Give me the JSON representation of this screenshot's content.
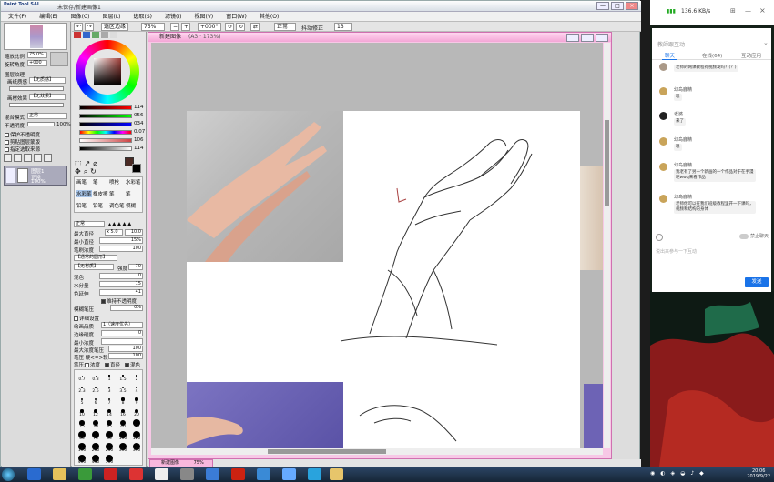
{
  "app": {
    "logo": "Paint Tool SAI",
    "document_title": "未保存/新建画像1",
    "window_controls": [
      "—",
      "□",
      "×"
    ]
  },
  "menubar": [
    "文件(F)",
    "编辑(E)",
    "图像(C)",
    "图层(L)",
    "选取(S)",
    "滤镜(I)",
    "视图(V)",
    "窗口(W)",
    "其他(O)"
  ],
  "toolbar": {
    "select_label": "选区边缘",
    "zoom": "75%",
    "angle": "+000°",
    "mode": "正常",
    "stabilizer_label": "抖动修正",
    "stabilizer_value": "13"
  },
  "left_panel": {
    "navigator_zoom_label": "缩放比例",
    "navigator_zoom": "75.0%",
    "navigator_angle_label": "旋转角度",
    "navigator_angle": "+000",
    "paper_section": "图层纹理",
    "paper_texture_label": "画纸质感",
    "paper_texture_value": "【无质感】",
    "paper_effect_label": "画材效果",
    "paper_effect_value": "【无效果】",
    "blend_label": "混合模式",
    "blend_value": "正常",
    "opacity_label": "不透明度",
    "opacity_value": "100%",
    "checkboxes": [
      "保护不透明度",
      "剪贴图层蒙版",
      "指定选取来源"
    ],
    "layers": [
      {
        "name": "图层1",
        "mode": "正常",
        "opacity": "100%"
      }
    ]
  },
  "tool_panel": {
    "color_values": [
      "114",
      "056",
      "034",
      "0.07",
      "106",
      "114"
    ],
    "tools": [
      [
        "画笔",
        "笔",
        "喷枪",
        "水彩笔"
      ],
      [
        "水彩笔",
        "橡皮擦",
        "笔",
        "笔"
      ],
      [
        "铅笔",
        "铅笔",
        "调色笔",
        "模糊"
      ]
    ],
    "brush_mode": "正常",
    "max_size_label": "最大直径",
    "max_size_mult": "x 5.0",
    "max_size_value": "10.0",
    "min_size_label": "最小直径",
    "min_size_value": "15%",
    "density_label": "笔刷浓度",
    "density_value": "100",
    "shape_value": "【通常的圆形】",
    "texture_value": "【无材质】",
    "texture_strength_label": "强度",
    "texture_strength_value": "70",
    "blending_label": "混色",
    "blending_value": "0",
    "water_label": "水分量",
    "water_value": "15",
    "persistence_label": "色延伸",
    "persistence_value": "41",
    "keep_opacity_label": "维持不透明度",
    "blur_label": "模糊笔压",
    "blur_value": "0%",
    "detail_label": "详细设置",
    "quality_label": "绘画品质",
    "quality_value": "1（速度优先）",
    "edge_label": "边缘硬度",
    "edge_value": "0",
    "min_density_label": "最小浓度",
    "max_pressure_label": "最大浓度笔压",
    "max_pressure_value": "100",
    "pressure_label": "笔压 硬<=>软",
    "pressure_value": "100",
    "pressure_opts_label": "笔压:",
    "pressure_opts": [
      "浓度",
      "直径",
      "混色"
    ],
    "brush_sizes": [
      [
        "0.7",
        "0.8",
        "1",
        "1.5",
        "2"
      ],
      [
        "2.3",
        "2.6",
        "3",
        "3.5",
        "4"
      ],
      [
        "5",
        "6",
        "7",
        "8",
        "9"
      ],
      [
        "10",
        "12",
        "14",
        "16",
        "20"
      ],
      [
        "25",
        "30",
        "35",
        "40",
        "50"
      ],
      [
        "60",
        "70",
        "80",
        "100",
        "120"
      ],
      [
        "160",
        "200",
        "250",
        "300",
        "350"
      ],
      [
        "400",
        "450",
        "500",
        "",
        ""
      ]
    ]
  },
  "canvas": {
    "title": "新建图像",
    "size": "(A3 · 173%)",
    "nav_tab": "新建图像",
    "nav_zoom": "75%"
  },
  "chat": {
    "network_speed": "136.6 KB/s",
    "title": "教師跟互动",
    "tabs": [
      "聊天",
      "在线(64)",
      "互动应用"
    ],
    "messages": [
      {
        "name": "",
        "text": "老师的网课教程有视频发吗？(？)"
      },
      {
        "name": "幻岛鹿精",
        "text": "嗯"
      },
      {
        "name": "老婆",
        "text": "来了"
      },
      {
        "name": "幻岛鹿精",
        "text": "嗯"
      },
      {
        "name": "幻岛鹿精",
        "text": "我老有了另一个新画的一个作品对于在手漫呢wwq来看作品"
      },
      {
        "name": "幻岛鹿精",
        "text": "老师你可以在我们班级教程里开一下课吗，视频和结构的身体"
      }
    ],
    "mute_label": "禁止聊天",
    "input_placeholder": "说出来参与一下互动",
    "send_button": "发送"
  },
  "taskbar": {
    "time": "20:06",
    "date": "2019/9/22"
  }
}
